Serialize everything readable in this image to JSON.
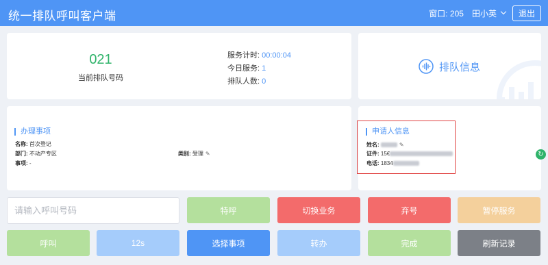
{
  "header": {
    "title": "统一排队呼叫客户端",
    "window_info": "窗口: 205",
    "user_name": "田小英",
    "logout_label": "退出"
  },
  "current_queue": {
    "number": "021",
    "label": "当前排队号码",
    "stats": {
      "timer_label": "服务计时:",
      "timer_value": "00:00:04",
      "today_label": "今日服务:",
      "today_value": "1",
      "queue_label": "排队人数:",
      "queue_value": "0"
    }
  },
  "queue_info": {
    "label": "排队信息",
    "icon": "voice-wave-icon"
  },
  "business": {
    "title": "办理事项",
    "name_label": "名称:",
    "name_value": "首次登记",
    "dept_label": "部门:",
    "dept_value": "不动产专区",
    "category_label": "类别:",
    "category_value": "受理",
    "item_label": "事项:",
    "item_value": "-"
  },
  "applicant": {
    "title": "申请人信息",
    "name_label": "姓名:",
    "name_value": "",
    "id_label": "证件:",
    "id_value": "15€",
    "phone_label": "电话:",
    "phone_value": "1834"
  },
  "call_input": {
    "placeholder": "请输入呼叫号码"
  },
  "buttons": {
    "special_call": "特呼",
    "switch_business": "切换业务",
    "abandon": "弃号",
    "pause_service": "暂停服务",
    "call": "呼叫",
    "countdown": "12s",
    "select_item": "选择事项",
    "transfer": "转办",
    "complete": "完成",
    "refresh_records": "刷新记录"
  },
  "colors": {
    "brand": "#4f95f5",
    "success": "#2fb36a",
    "danger": "#f36b6b",
    "warning": "#f4d09c",
    "disabled_green": "#b4e09d",
    "disabled_blue": "#a5ccfb",
    "gray": "#7c8087"
  }
}
